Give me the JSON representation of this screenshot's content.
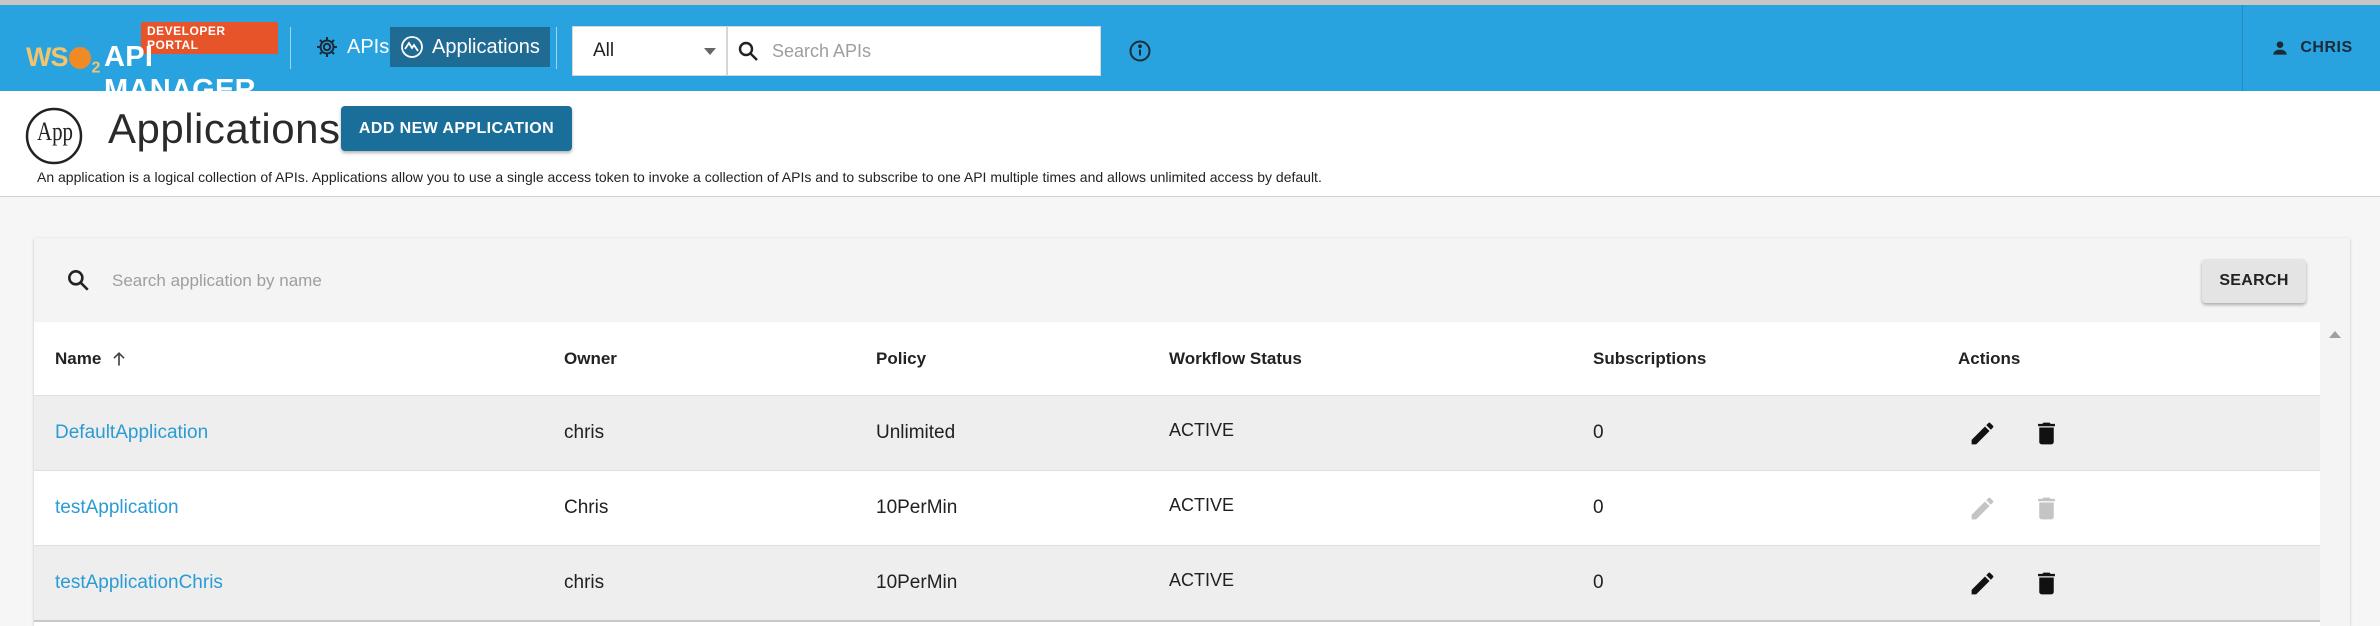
{
  "header": {
    "badge": "DEVELOPER PORTAL",
    "brand_wso": "WS",
    "brand_two": "2",
    "brand_name": "API MANAGER",
    "nav": [
      {
        "label": "APIs",
        "icon": "gear-icon",
        "active": false
      },
      {
        "label": "Applications",
        "icon": "applications-icon",
        "active": true
      }
    ],
    "filter_value": "All",
    "search_placeholder": "Search APIs",
    "user_name": "CHRIS"
  },
  "page": {
    "title": "Applications",
    "app_icon_text": "App",
    "add_button": "ADD NEW APPLICATION",
    "description": "An application is a logical collection of APIs. Applications allow you to use a single access token to invoke a collection of APIs and to subscribe to one API multiple times and allows unlimited access by default."
  },
  "panel": {
    "search_placeholder": "Search application by name",
    "search_button": "SEARCH",
    "columns": {
      "name": "Name",
      "owner": "Owner",
      "policy": "Policy",
      "status": "Workflow Status",
      "subscriptions": "Subscriptions",
      "actions": "Actions"
    },
    "rows": [
      {
        "name": "DefaultApplication",
        "owner": "chris",
        "policy": "Unlimited",
        "status": "ACTIVE",
        "subscriptions": "0",
        "actions_enabled": true
      },
      {
        "name": "testApplication",
        "owner": "Chris",
        "policy": "10PerMin",
        "status": "ACTIVE",
        "subscriptions": "0",
        "actions_enabled": false
      },
      {
        "name": "testApplicationChris",
        "owner": "chris",
        "policy": "10PerMin",
        "status": "ACTIVE",
        "subscriptions": "0",
        "actions_enabled": true
      }
    ]
  },
  "colors": {
    "topbar": "#29a3df",
    "accent_button": "#1a6e9a",
    "link": "#2b9bd4",
    "badge": "#e8542a"
  }
}
